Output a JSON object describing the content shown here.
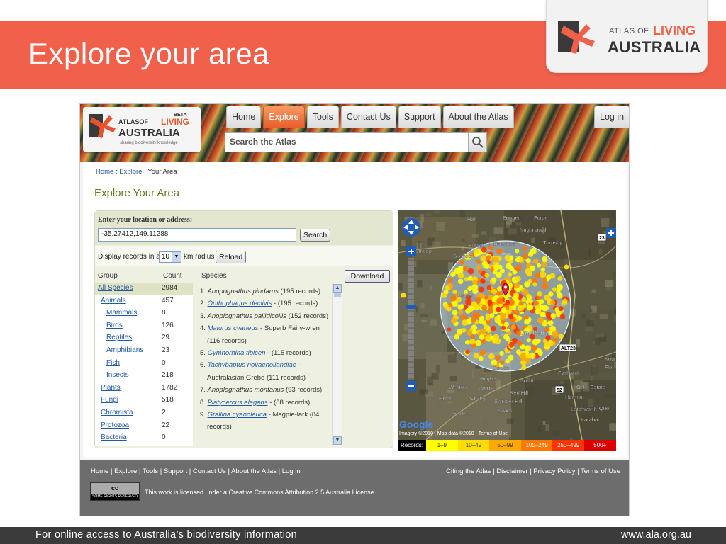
{
  "slide": {
    "title": "Explore your area",
    "logo": {
      "prefix": "ATLAS OF",
      "highlight": "LIVING",
      "main": "AUSTRALIA"
    },
    "footer_left": "For online access to Australia’s biodiversity information",
    "footer_right": "www.ala.org.au"
  },
  "site": {
    "logo": {
      "beta": "BETA",
      "prefix": "ATLASOF",
      "highlight": "LIVING",
      "main": "AUSTRALIA",
      "tagline": "sharing biodiversity knowledge"
    },
    "nav": [
      "Home",
      "Explore",
      "Tools",
      "Contact Us",
      "Support",
      "About the Atlas"
    ],
    "active_nav": "Explore",
    "login": "Log in",
    "search_placeholder": "Search the Atlas",
    "breadcrumb": {
      "home": "Home",
      "sep1": " : ",
      "explore": "Explore",
      "sep2": " : ",
      "current": "Your Area"
    },
    "page_heading": "Explore Your Area",
    "location": {
      "label": "Enter your location or address:",
      "value": "-35.27412,149.11288",
      "search_button": "Search",
      "radius_prefix": "Display records in a",
      "radius_value": "10",
      "radius_suffix": "km radius",
      "reload_button": "Reload"
    },
    "table": {
      "headers": {
        "group": "Group",
        "count": "Count",
        "species": "Species"
      },
      "download_button": "Download",
      "groups": [
        {
          "name": "All Species",
          "count": "2984"
        },
        {
          "name": "Animals",
          "count": "457"
        },
        {
          "name": "Mammals",
          "count": "8"
        },
        {
          "name": "Birds",
          "count": "126"
        },
        {
          "name": "Reptiles",
          "count": "29"
        },
        {
          "name": "Amphibians",
          "count": "23"
        },
        {
          "name": "Fish",
          "count": "0"
        },
        {
          "name": "Insects",
          "count": "218"
        },
        {
          "name": "Plants",
          "count": "1782"
        },
        {
          "name": "Fungi",
          "count": "518"
        },
        {
          "name": "Chromista",
          "count": "2"
        },
        {
          "name": "Protozoa",
          "count": "22"
        },
        {
          "name": "Bacteria",
          "count": "0"
        }
      ],
      "species": [
        {
          "num": "1.",
          "name": "Anopognathus pindarus",
          "common": "",
          "records": " (195 records)",
          "linked": false
        },
        {
          "num": "2.",
          "name": "Onthophagus declivis",
          "common": "",
          "records": " - (195 records)",
          "linked": true
        },
        {
          "num": "3.",
          "name": "Anoplognathus pallidicollis",
          "common": "",
          "records": " (152 records)",
          "linked": false
        },
        {
          "num": "4.",
          "name": "Malurus cyaneus",
          "common": " - Superb Fairy-wren",
          "records": " (116 records)",
          "linked": true
        },
        {
          "num": "5.",
          "name": "Gymnorhina tibicen",
          "common": "",
          "records": " - (115 records)",
          "linked": true
        },
        {
          "num": "6.",
          "name": "Tachybaptus novaehollandiae",
          "common": " - Australasian Grebe",
          "records": " (111 records)",
          "linked": true
        },
        {
          "num": "7.",
          "name": "Anoplognathus montanus",
          "common": "",
          "records": " (93 records)",
          "linked": false
        },
        {
          "num": "8.",
          "name": "Platycercus elegans",
          "common": "",
          "records": " - (88 records)",
          "linked": true
        },
        {
          "num": "9.",
          "name": "Grallina cyanoleuca",
          "common": " - Magpie-lark",
          "records": " (84 records)",
          "linked": true
        }
      ]
    },
    "map": {
      "place_labels": [
        "Hall",
        "Bonner",
        "Forde",
        "Nugunawal",
        "Throsby",
        "Fraser",
        "Palmerston",
        "Dunlop",
        "Spence",
        "Hawker",
        "Canberra",
        "Weston",
        "Lyons",
        "Hughes",
        "Griffith",
        "Red Hill",
        "Fyshwick",
        "Oaks Estate",
        "Rivett",
        "Chifley",
        "Swinger Hill",
        "Harman",
        "Isaacs",
        "Fisher",
        "Letchworth",
        "Que",
        "Karabar",
        "Kow",
        "Flo",
        "Deakin"
      ],
      "attribution": "Imagery ©2010 , Map data ©2010 - Terms of Use",
      "google": "Google",
      "road_labels": [
        "23",
        "ALT23",
        "52"
      ],
      "legend_label": "Records:",
      "legend": [
        {
          "label": "1–9",
          "color": "#ffff00"
        },
        {
          "label": "10–49",
          "color": "#ffdd00"
        },
        {
          "label": "50–99",
          "color": "#ffaa00"
        },
        {
          "label": "100–249",
          "color": "#ff7700"
        },
        {
          "label": "250–499",
          "color": "#ff3300"
        },
        {
          "label": "500+",
          "color": "#dd0000"
        }
      ]
    },
    "footer": {
      "links": [
        "Home",
        "Explore",
        "Tools",
        "Support",
        "Contact Us",
        "About the Atlas",
        "Log in"
      ],
      "right_links": [
        "Citing the Atlas",
        "Disclaimer",
        "Privacy Policy",
        "Terms of Use"
      ],
      "cc_badge": "cc",
      "cc_rights": "SOME RIGHTS RESERVED",
      "license": "This work is licensed under a Creative Commons Attribution 2.5 Australia License"
    }
  },
  "colors": {
    "brand": "#f0604a",
    "olive": "#6b7a26",
    "link": "#1f5aa3"
  }
}
